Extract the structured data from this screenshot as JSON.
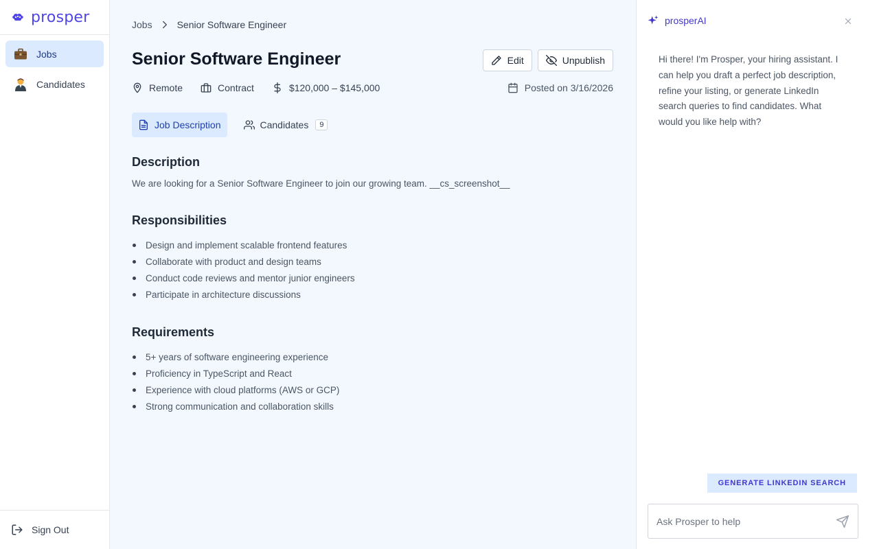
{
  "colors": {
    "brand": "#4f46e5",
    "active_bg": "#dbeafe",
    "main_bg": "#f2f8fd"
  },
  "sidebar": {
    "logo_text": "prosper",
    "logo_icon": "brain-icon",
    "items": [
      {
        "label": "Jobs",
        "icon": "briefcase-icon",
        "active": true
      },
      {
        "label": "Candidates",
        "icon": "person-icon",
        "active": false
      }
    ],
    "sign_out": "Sign Out"
  },
  "breadcrumb": {
    "parent": "Jobs",
    "current": "Senior Software Engineer"
  },
  "job": {
    "title": "Senior Software Engineer",
    "location": "Remote",
    "type": "Contract",
    "salary": "$120,000 – $145,000",
    "posted": "Posted on 3/16/2026"
  },
  "actions": {
    "edit": "Edit",
    "unpublish": "Unpublish"
  },
  "tabs": [
    {
      "label": "Job Description",
      "active": true
    },
    {
      "label": "Candidates",
      "count": "9",
      "active": false
    }
  ],
  "content": {
    "description_heading": "Description",
    "description_text": "We are looking for a Senior Software Engineer to join our growing team. __cs_screenshot__",
    "responsibilities_heading": "Responsibilities",
    "responsibilities": [
      "Design and implement scalable frontend features",
      "Collaborate with product and design teams",
      "Conduct code reviews and mentor junior engineers",
      "Participate in architecture discussions"
    ],
    "requirements_heading": "Requirements",
    "requirements": [
      "5+ years of software engineering experience",
      "Proficiency in TypeScript and React",
      "Experience with cloud platforms (AWS or GCP)",
      "Strong communication and collaboration skills"
    ]
  },
  "ai": {
    "title": "prosperAI",
    "message": "Hi there! I'm Prosper, your hiring assistant. I can help you draft a perfect job description, refine your listing, or generate LinkedIn search queries to find candidates. What would you like help with?",
    "generate_button": "GENERATE LINKEDIN SEARCH",
    "input_placeholder": "Ask Prosper to help",
    "input_value": ""
  }
}
